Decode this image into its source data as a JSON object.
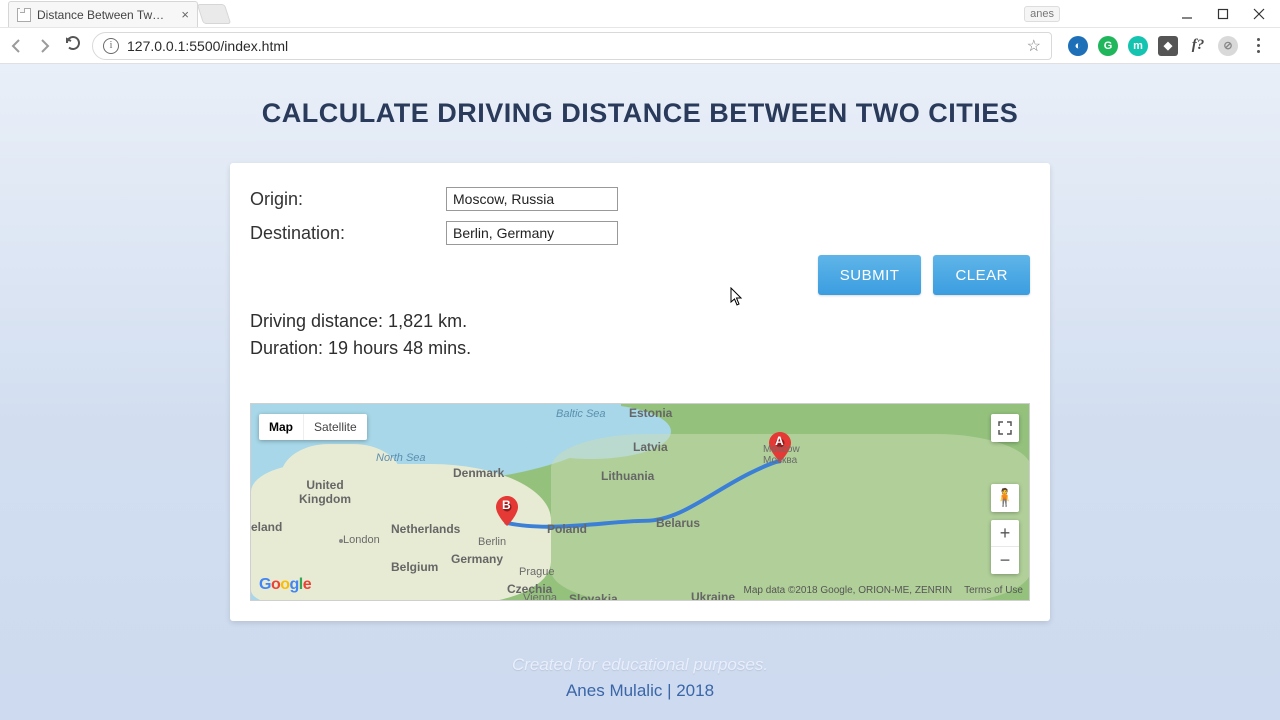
{
  "browser": {
    "window_label": "anes",
    "tab_title": "Distance Between Two C",
    "url": "127.0.0.1:5500/index.html"
  },
  "page": {
    "title": "CALCULATE DRIVING DISTANCE BETWEEN TWO CITIES",
    "form": {
      "origin_label": "Origin:",
      "origin_value": "Moscow, Russia",
      "destination_label": "Destination:",
      "destination_value": "Berlin, Germany",
      "submit_label": "SUBMIT",
      "clear_label": "CLEAR"
    },
    "results": {
      "distance": "Driving distance: 1,821 km.",
      "duration": "Duration: 19 hours 48 mins."
    },
    "map": {
      "type_map": "Map",
      "type_satellite": "Satellite",
      "marker_a": "A",
      "marker_b": "B",
      "attribution": "Map data ©2018 Google, ORION-ME, ZENRIN",
      "terms": "Terms of Use",
      "labels": {
        "baltic_sea": "Baltic Sea",
        "north_sea": "North Sea",
        "estonia": "Estonia",
        "latvia": "Latvia",
        "lithuania": "Lithuania",
        "belarus": "Belarus",
        "poland": "Poland",
        "germany": "Germany",
        "denmark": "Denmark",
        "uk": "United\nKingdom",
        "ireland": "eland",
        "netherlands": "Netherlands",
        "belgium": "Belgium",
        "czechia": "Czechia",
        "slovakia": "Slovakia",
        "ukraine": "Ukraine",
        "london": "London",
        "berlin": "Berlin",
        "prague": "Prague",
        "vienna": "Vienna",
        "moscow": "Moscow\nМосква"
      }
    },
    "footer": {
      "line1": "Created for educational purposes.",
      "line2": "Anes Mulalic | 2018"
    }
  }
}
